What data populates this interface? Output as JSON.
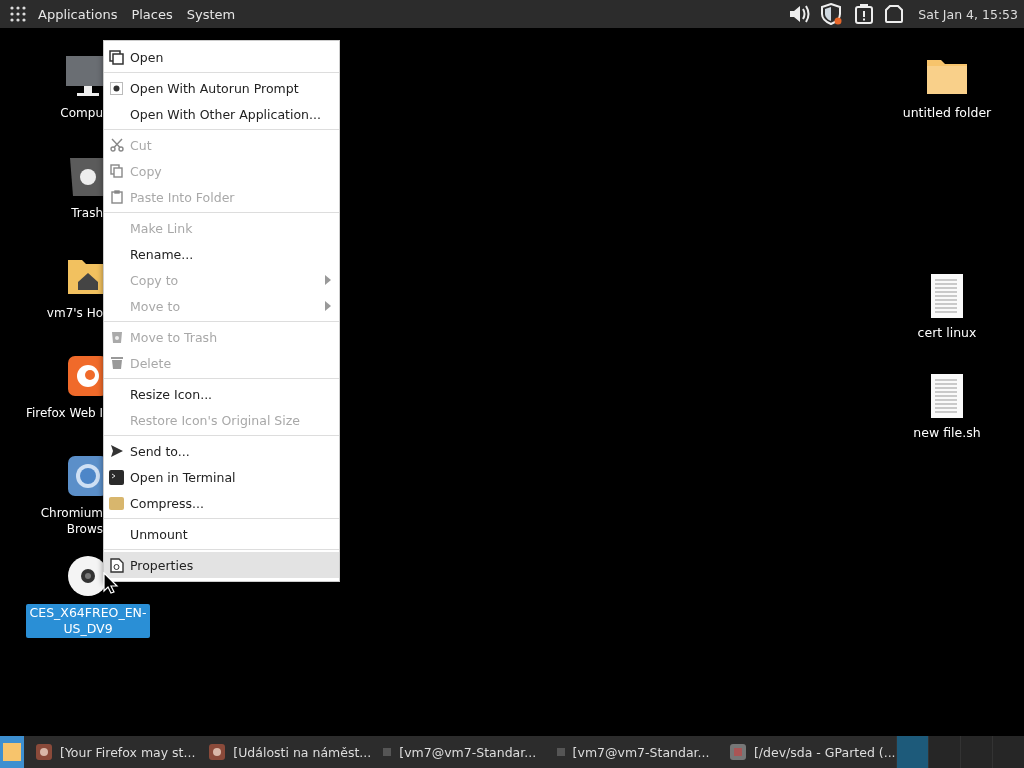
{
  "top_panel": {
    "menus": [
      "Applications",
      "Places",
      "System"
    ],
    "clock": "Sat Jan 4, 15:53"
  },
  "desktop_icons": [
    {
      "kind": "computer",
      "label": "Compu",
      "selected": false
    },
    {
      "kind": "trash",
      "label": "Trash",
      "selected": false
    },
    {
      "kind": "home",
      "label": "vm7's Ho",
      "selected": false
    },
    {
      "kind": "firefox",
      "label": "Firefox Web I",
      "selected": false
    },
    {
      "kind": "chromium",
      "label": "Chromium\nBrows",
      "selected": false
    },
    {
      "kind": "disc",
      "label": "CES_X64FREO_EN-US_DV9",
      "selected": true
    },
    {
      "kind": "folder",
      "label": "untitled folder",
      "selected": false
    },
    {
      "kind": "document",
      "label": "cert linux",
      "selected": false
    },
    {
      "kind": "document",
      "label": "new file.sh",
      "selected": false
    }
  ],
  "context_menu": {
    "groups": [
      [
        {
          "label": "Open",
          "disabled": false,
          "submenu": false,
          "selected": false
        }
      ],
      [
        {
          "label": "Open With Autorun Prompt",
          "disabled": false,
          "submenu": false,
          "selected": false
        },
        {
          "label": "Open With Other Application...",
          "disabled": false,
          "submenu": false,
          "selected": false
        }
      ],
      [
        {
          "label": "Cut",
          "disabled": true,
          "submenu": false,
          "selected": false
        },
        {
          "label": "Copy",
          "disabled": true,
          "submenu": false,
          "selected": false
        },
        {
          "label": "Paste Into Folder",
          "disabled": true,
          "submenu": false,
          "selected": false
        }
      ],
      [
        {
          "label": "Make Link",
          "disabled": true,
          "submenu": false,
          "selected": false
        },
        {
          "label": "Rename...",
          "disabled": false,
          "submenu": false,
          "selected": false
        },
        {
          "label": "Copy to",
          "disabled": true,
          "submenu": true,
          "selected": false
        },
        {
          "label": "Move to",
          "disabled": true,
          "submenu": true,
          "selected": false
        }
      ],
      [
        {
          "label": "Move to Trash",
          "disabled": true,
          "submenu": false,
          "selected": false
        },
        {
          "label": "Delete",
          "disabled": true,
          "submenu": false,
          "selected": false
        }
      ],
      [
        {
          "label": "Resize Icon...",
          "disabled": false,
          "submenu": false,
          "selected": false
        },
        {
          "label": "Restore Icon's Original Size",
          "disabled": true,
          "submenu": false,
          "selected": false
        }
      ],
      [
        {
          "label": "Send to...",
          "disabled": false,
          "submenu": false,
          "selected": false
        },
        {
          "label": "Open in Terminal",
          "disabled": false,
          "submenu": false,
          "selected": false
        },
        {
          "label": "Compress...",
          "disabled": false,
          "submenu": false,
          "selected": false
        }
      ],
      [
        {
          "label": "Unmount",
          "disabled": false,
          "submenu": false,
          "selected": false
        }
      ],
      [
        {
          "label": "Properties",
          "disabled": false,
          "submenu": false,
          "selected": true
        }
      ]
    ]
  },
  "taskbar": {
    "tasks": [
      "[Your Firefox may st...",
      "[Události na náměst...",
      "[vm7@vm7-Standar...",
      "[vm7@vm7-Standar...",
      "[/dev/sda - GParted (..."
    ],
    "workspaces": [
      {
        "selected": true
      },
      {
        "selected": false
      },
      {
        "selected": false
      },
      {
        "selected": false
      }
    ]
  }
}
